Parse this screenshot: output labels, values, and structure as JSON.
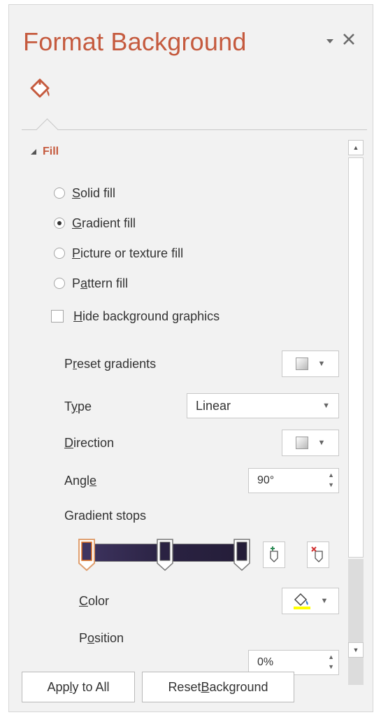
{
  "pane": {
    "title": "Format Background",
    "dropdown_icon": "caret-down-icon",
    "close_icon": "close-icon",
    "tab_icon": "fill-bucket-icon"
  },
  "fill_section": {
    "label": "Fill",
    "options": [
      {
        "pre": "",
        "ul": "S",
        "post": "olid fill",
        "selected": false
      },
      {
        "pre": "",
        "ul": "G",
        "post": "radient fill",
        "selected": true
      },
      {
        "pre": "",
        "ul": "P",
        "post": "icture or texture fill",
        "selected": false
      },
      {
        "pre": "P",
        "ul": "a",
        "post": "ttern fill",
        "selected": false
      }
    ],
    "hide_graphics": {
      "pre": "",
      "ul": "H",
      "post": "ide background graphics",
      "checked": false
    }
  },
  "gradient": {
    "preset": {
      "pre": "P",
      "ul": "r",
      "post": "eset gradients"
    },
    "type": {
      "pre": "T",
      "ul": "y",
      "post": "pe",
      "value": "Linear"
    },
    "direction": {
      "pre": "",
      "ul": "D",
      "post": "irection"
    },
    "angle": {
      "pre": "Angl",
      "ul": "e",
      "post": "",
      "value": "90°"
    },
    "stops_label": "Gradient stops",
    "color": {
      "pre": "",
      "ul": "C",
      "post": "olor"
    },
    "position": {
      "pre": "P",
      "ul": "o",
      "post": "sition",
      "value": "0%"
    }
  },
  "buttons": {
    "apply_all": {
      "pre": "App",
      "ul": "l",
      "post": "y to All"
    },
    "reset": {
      "pre": "Reset ",
      "ul": "B",
      "post": "ackground"
    }
  },
  "colors": {
    "accent": "#c55a3e",
    "gradient_dark": "#241d38",
    "highlight": "#ffff00"
  }
}
